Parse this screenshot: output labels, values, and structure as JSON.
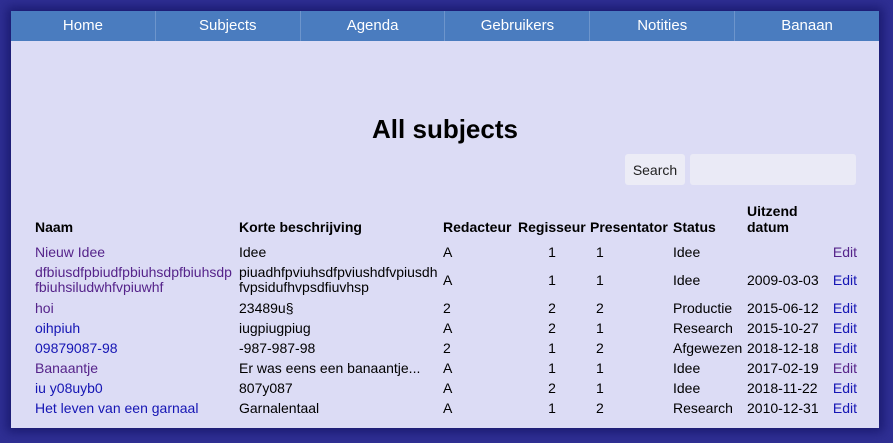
{
  "nav": {
    "items": [
      {
        "label": "Home"
      },
      {
        "label": "Subjects"
      },
      {
        "label": "Agenda"
      },
      {
        "label": "Gebruikers"
      },
      {
        "label": "Notities"
      },
      {
        "label": "Banaan"
      }
    ]
  },
  "page": {
    "title": "All subjects"
  },
  "search": {
    "button_label": "Search",
    "value": ""
  },
  "table": {
    "headers": {
      "naam": "Naam",
      "korte": "Korte beschrijving",
      "redacteur": "Redacteur",
      "regisseur": "Regisseur",
      "presentator": "Presentator",
      "status": "Status",
      "datum": "Uitzend datum"
    },
    "edit_label": "Edit",
    "rows": [
      {
        "naam": "Nieuw Idee",
        "korte": "Idee",
        "redacteur": "A",
        "regisseur": "1",
        "presentator": "1",
        "status": "Idee",
        "datum": ""
      },
      {
        "naam": "dfbiusdfpbiudfpbiuhsdpfbiuhsdpfbiuhsiludwhfvpiuwhf",
        "korte": "piuadhfpviuhsdfpviushdfvpiusdhfvpsidufhvpsdfiuvhsp",
        "redacteur": "A",
        "regisseur": "1",
        "presentator": "1",
        "status": "Idee",
        "datum": "2009-03-03"
      },
      {
        "naam": "hoi",
        "korte": "23489u§",
        "redacteur": "2",
        "regisseur": "2",
        "presentator": "2",
        "status": "Productie",
        "datum": "2015-06-12"
      },
      {
        "naam": "oihpiuh",
        "korte": "iugpiugpiug",
        "redacteur": "A",
        "regisseur": "2",
        "presentator": "1",
        "status": "Research",
        "datum": "2015-10-27"
      },
      {
        "naam": "09879087-98",
        "korte": "-987-987-98",
        "redacteur": "2",
        "regisseur": "1",
        "presentator": "2",
        "status": "Afgewezen",
        "datum": "2018-12-18"
      },
      {
        "naam": "Banaantje",
        "korte": "Er was eens een banaantje...",
        "redacteur": "A",
        "regisseur": "1",
        "presentator": "1",
        "status": "Idee",
        "datum": "2017-02-19"
      },
      {
        "naam": "iu y08uyb0",
        "korte": "807y087",
        "redacteur": "A",
        "regisseur": "2",
        "presentator": "1",
        "status": "Idee",
        "datum": "2018-11-22"
      },
      {
        "naam": "Het leven van een garnaal",
        "korte": "Garnalentaal",
        "redacteur": "A",
        "regisseur": "1",
        "presentator": "2",
        "status": "Research",
        "datum": "2010-12-31"
      }
    ]
  },
  "colors": {
    "page_border": "#2f2f93",
    "content_bg": "#dcdcf5",
    "nav_bg": "#4a7cbf",
    "link": "#1515b4",
    "visited_link": "#55238a"
  }
}
